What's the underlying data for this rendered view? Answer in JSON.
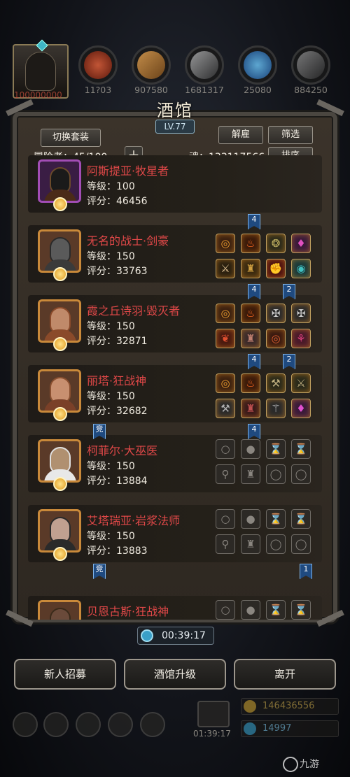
{
  "top": {
    "hero_value": "100000000",
    "resources": [
      {
        "icon": "fire-orb-icon",
        "value": "11?03",
        "color": "#c04020"
      },
      {
        "icon": "scroll-icon",
        "value": "907580",
        "color": "#d08030"
      },
      {
        "icon": "anvil-icon",
        "value": "1681317",
        "color": "#8a8a8a"
      },
      {
        "icon": "crystal-icon",
        "value": "25080",
        "color": "#3a8ad0"
      },
      {
        "icon": "hammer-icon",
        "value": "884250",
        "color": "#6a6a6a"
      }
    ]
  },
  "panel": {
    "title": "酒馆",
    "level": "LV.77",
    "switch_outfit": "切换套装",
    "dismiss": "解雇",
    "filter": "筛选",
    "sort": "排序",
    "adventurers": "冒险者：45/100",
    "soul": "魂：133117566"
  },
  "heroes": [
    {
      "name": "阿斯提亚·牧星者",
      "level": "等级：100",
      "score": "评分：46456",
      "frame": "purple",
      "equipped": false
    },
    {
      "name": "无名的战士·剑豪",
      "level": "等级：150",
      "score": "评分：33763",
      "frame": "orange",
      "equipped": true
    },
    {
      "name": "霞之丘诗羽·毁灭者",
      "level": "等级：150",
      "score": "评分：32871",
      "frame": "orange",
      "equipped": true
    },
    {
      "name": "丽塔·狂战神",
      "level": "等级：150",
      "score": "评分：32682",
      "frame": "orange",
      "equipped": true
    },
    {
      "name": "柯菲尔·大巫医",
      "level": "等级：150",
      "score": "评分：13884",
      "frame": "orange",
      "equipped": false
    },
    {
      "name": "艾塔瑞亚·岩浆法师",
      "level": "等级：150",
      "score": "评分：13883",
      "frame": "orange",
      "equipped": false
    },
    {
      "name": "贝恩古斯·狂战神",
      "level": "",
      "score": "",
      "frame": "orange",
      "equipped": false
    }
  ],
  "tags": {
    "t1": "4",
    "t2": "4",
    "t3": "2",
    "t4": "4",
    "t5": "2",
    "t6": "竞",
    "t7": "4",
    "t8": "竞",
    "t9": "1"
  },
  "footer": {
    "timer": "00:39:17",
    "recruit": "新人招募",
    "upgrade": "酒馆升级",
    "leave": "离开",
    "dock_timer": "01:39:17",
    "gold": "146436556",
    "gems": "14997",
    "watermark": "九游"
  }
}
